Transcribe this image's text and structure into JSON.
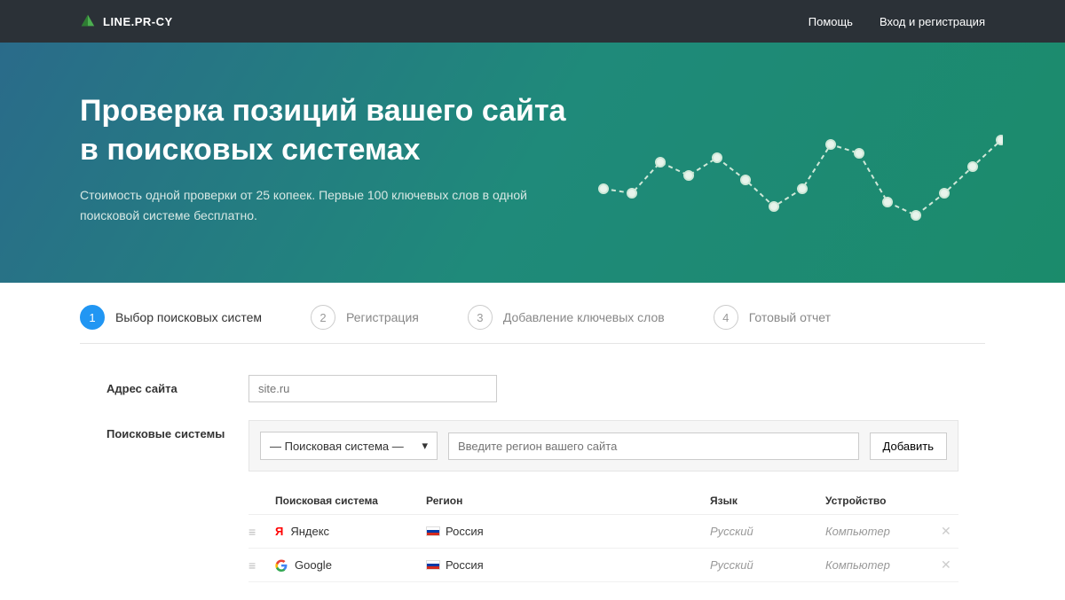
{
  "navbar": {
    "logo_text": "LINE.PR-CY",
    "help": "Помощь",
    "login": "Вход и регистрация"
  },
  "hero": {
    "title_line1": "Проверка позиций вашего сайта",
    "title_line2": "в поисковых системах",
    "subtitle": "Стоимость одной проверки от 25 копеек. Первые 100 ключевых слов в одной поисковой системе бесплатно."
  },
  "steps": [
    {
      "num": "1",
      "label": "Выбор поисковых систем",
      "active": true
    },
    {
      "num": "2",
      "label": "Регистрация",
      "active": false
    },
    {
      "num": "3",
      "label": "Добавление ключевых слов",
      "active": false
    },
    {
      "num": "4",
      "label": "Готовый отчет",
      "active": false
    }
  ],
  "form": {
    "site_label": "Адрес сайта",
    "site_placeholder": "site.ru",
    "engines_label": "Поисковые системы",
    "select_placeholder": "— Поисковая система —",
    "region_placeholder": "Введите регион вашего сайта",
    "add_button": "Добавить"
  },
  "table": {
    "headers": {
      "engine": "Поисковая система",
      "region": "Регион",
      "lang": "Язык",
      "device": "Устройство"
    },
    "rows": [
      {
        "engine": "Яндекс",
        "engine_icon": "yandex",
        "region": "Россия",
        "lang": "Русский",
        "device": "Компьютер"
      },
      {
        "engine": "Google",
        "engine_icon": "google",
        "region": "Россия",
        "lang": "Русский",
        "device": "Компьютер"
      }
    ]
  },
  "chart_data": {
    "type": "line",
    "title": "",
    "x": [
      0,
      1,
      2,
      3,
      4,
      5,
      6,
      7,
      8,
      9,
      10,
      11,
      12,
      13
    ],
    "values": [
      45,
      40,
      75,
      60,
      80,
      55,
      25,
      45,
      95,
      85,
      30,
      15,
      40,
      70,
      100
    ],
    "ylim": [
      0,
      100
    ],
    "style": "dashed-with-markers"
  }
}
